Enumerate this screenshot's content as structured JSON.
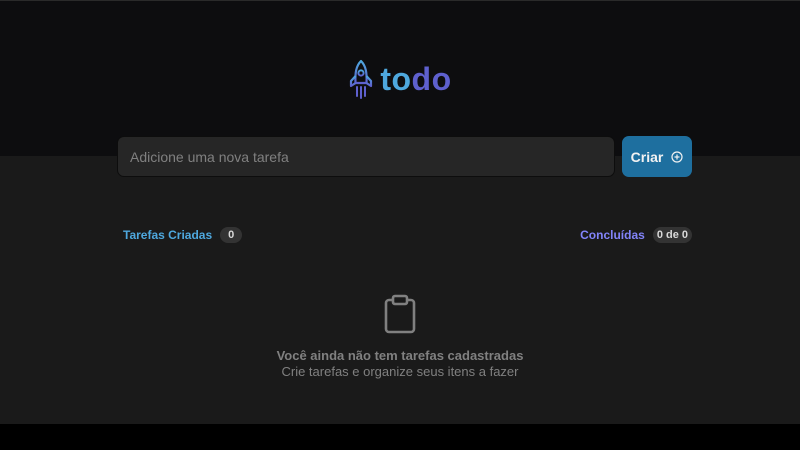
{
  "header": {
    "logo_icon": "rocket-icon",
    "logo_text_part1": "to",
    "logo_text_part2": "do"
  },
  "new_task": {
    "placeholder": "Adicione uma nova tarefa",
    "value": "",
    "create_label": "Criar",
    "create_icon": "plus-circle-icon"
  },
  "counters": {
    "created_label": "Tarefas Criadas",
    "created_count": "0",
    "done_label": "Concluídas",
    "done_count": "0 de 0"
  },
  "empty_state": {
    "icon": "clipboard-icon",
    "title": "Você ainda não tem tarefas cadastradas",
    "subtitle": "Crie tarefas e organize seus itens a fazer"
  },
  "colors": {
    "blue": "#4ea8de",
    "purple": "#5e60ce",
    "purple_light": "#8284fa",
    "button": "#1e6f9f",
    "background": "#1a1a1a",
    "header_background": "#0d0d0f"
  }
}
